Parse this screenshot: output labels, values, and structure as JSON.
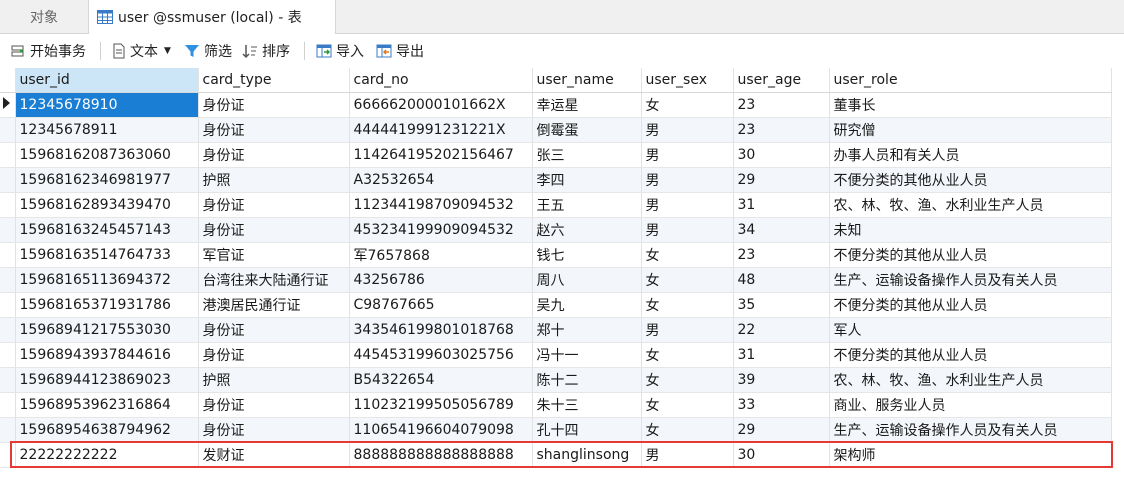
{
  "tabs": {
    "objects_label": "对象",
    "table_label": "user @ssmuser (local) - 表"
  },
  "toolbar": {
    "begin_transaction": "开始事务",
    "text": "文本",
    "filter": "筛选",
    "sort": "排序",
    "import": "导入",
    "export": "导出"
  },
  "columns": [
    "user_id",
    "card_type",
    "card_no",
    "user_name",
    "user_sex",
    "user_age",
    "user_role"
  ],
  "rows": [
    [
      "12345678910",
      "身份证",
      "666662000010166​2X",
      "幸运星",
      "女",
      "23",
      "董事长"
    ],
    [
      "12345678911",
      "身份证",
      "444441999123122​1X",
      "倒霉蛋",
      "男",
      "23",
      "研究僧"
    ],
    [
      "15968162087363060",
      "身份证",
      "11426419520215646​7",
      "张三",
      "男",
      "30",
      "办事人员和有关人员"
    ],
    [
      "15968162346981977",
      "护照",
      "A32532654",
      "李四",
      "男",
      "29",
      "不便分类的其他从业人员"
    ],
    [
      "15968162893439470",
      "身份证",
      "112344198709094532",
      "王五",
      "男",
      "31",
      "农、林、牧、渔、水利业生产人员"
    ],
    [
      "15968163245457143",
      "身份证",
      "453234199909094532",
      "赵六",
      "男",
      "34",
      "未知"
    ],
    [
      "15968163514764733",
      "军官证",
      "军7657868",
      "钱七",
      "女",
      "23",
      "不便分类的其他从业人员"
    ],
    [
      "15968165113694372",
      "台湾往来大陆通行证",
      "43256786",
      "周八",
      "女",
      "48",
      "生产、运输设备操作人员及有关人员"
    ],
    [
      "15968165371931786",
      "港澳居民通行证",
      "C98767665",
      "吴九",
      "女",
      "35",
      "不便分类的其他从业人员"
    ],
    [
      "15968941217553030",
      "身份证",
      "343546199801018768",
      "郑十",
      "男",
      "22",
      "军人"
    ],
    [
      "15968943937844616",
      "身份证",
      "445453199603025756",
      "冯十一",
      "女",
      "31",
      "不便分类的其他从业人员"
    ],
    [
      "15968944123869023",
      "护照",
      "B54322654",
      "陈十二",
      "女",
      "39",
      "农、林、牧、渔、水利业生产人员"
    ],
    [
      "15968953962316864",
      "身份证",
      "110232199505056789",
      "朱十三",
      "女",
      "33",
      "商业、服务业人员"
    ],
    [
      "15968954638794962",
      "身份证",
      "110654196604079098",
      "孔十四",
      "女",
      "29",
      "生产、运输设备操作人员及有关人员"
    ],
    [
      "22222222222",
      "发财证",
      "888888888888888888",
      "shanglinsong",
      "男",
      "30",
      "架构师"
    ]
  ],
  "colors": {
    "selected_cell": "#1a7fd4",
    "selected_header": "#cde6f7",
    "highlight_border": "#e53935",
    "alt_row": "#f3f7fb"
  }
}
